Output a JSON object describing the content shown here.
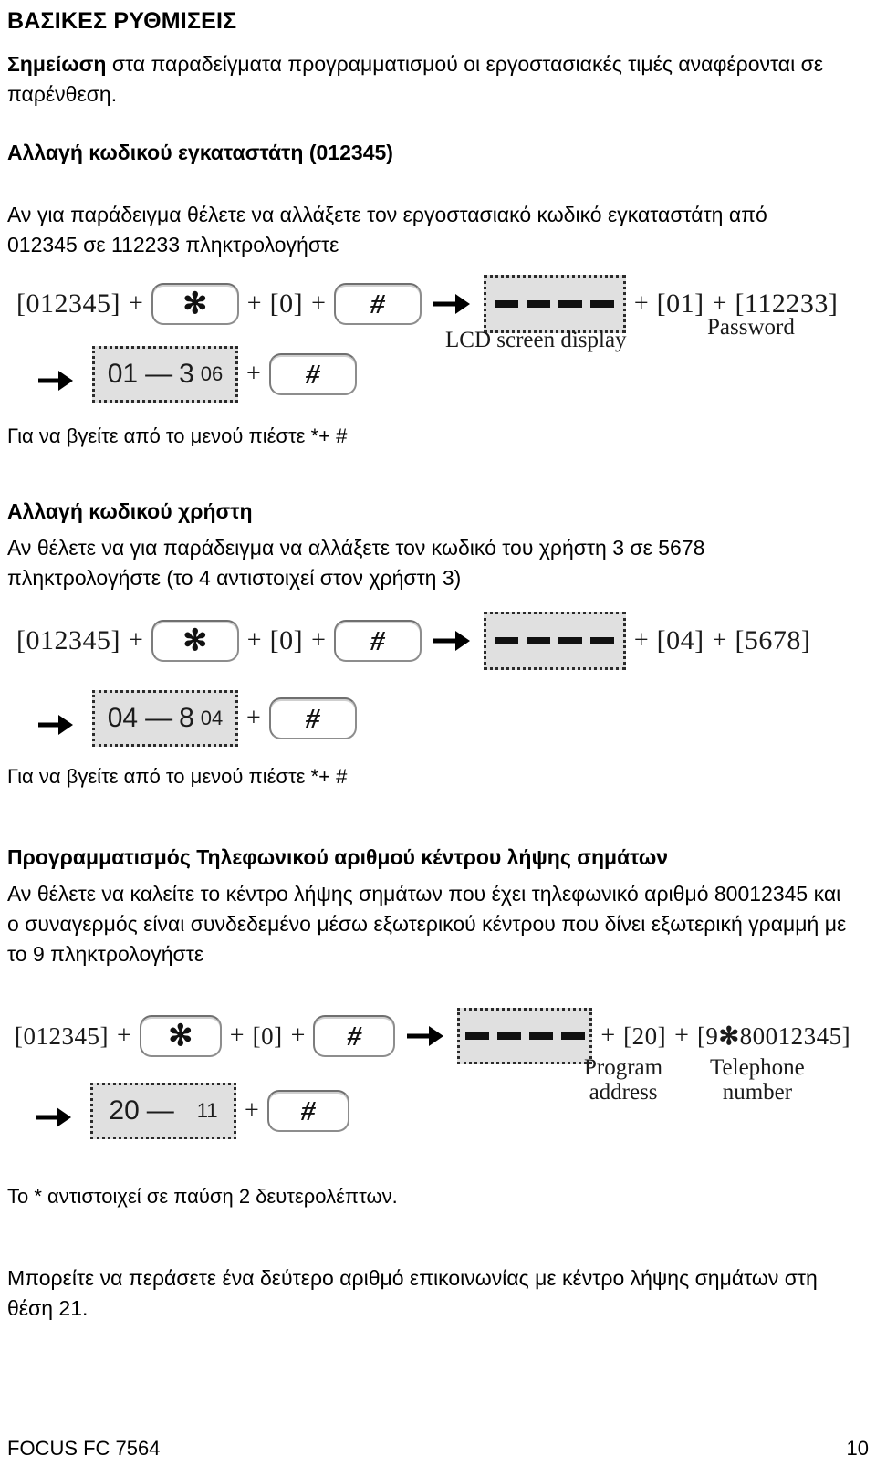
{
  "document": {
    "heading": "ΒΑΣΙΚΕΣ ΡΥΘΜΙΣΕΙΣ",
    "note_label": "Σημείωση",
    "note_text": " στα παραδείγματα προγραμματισμού οι εργοστασιακές τιμές αναφέρονται σε παρένθεση."
  },
  "section_installer": {
    "heading": "Αλλαγή κωδικού εγκαταστάτη (012345)",
    "paragraph": "Αν για παράδειγμα θέλετε να αλλάξετε τον εργοστασιακό κωδικό εγκαταστάτη από 012345 σε 112233 πληκτρολογήστε",
    "exit_note": "Για να βγείτε από το μενού πιέστε *+ #"
  },
  "section_user": {
    "heading": "Αλλαγή κωδικού χρήστη",
    "paragraph": "Αν θέλετε να για παράδειγμα να αλλάξετε τον κωδικό του χρήστη 3 σε 5678 πληκτρολογήστε (το 4 αντιστοιχεί στον χρήστη 3)",
    "exit_note": "Για να βγείτε από το μενού πιέστε *+ #"
  },
  "section_telephone": {
    "heading": "Προγραμματισμός Τηλεφωνικού αριθμού κέντρου λήψης σημάτων",
    "paragraph": "Αν θέλετε να καλείτε το κέντρο λήψης σημάτων που έχει τηλεφωνικό αριθμό 80012345 και ο συναγερμός είναι συνδεδεμένο μέσω εξωτερικού κέντρου που δίνει εξωτερική γραμμή με το 9 πληκτρολογήστε",
    "pause_note": "Το * αντιστοιχεί σε παύση 2 δευτερολέπτων.",
    "second_number_note": "Μπορείτε να περάσετε ένα δεύτερο αριθμό επικοινωνίας με κέντρο λήψης σημάτων στη θέση 21."
  },
  "diagram1": {
    "installer_code": "[012345]",
    "plus": "+",
    "key_star": "✻",
    "zero_code": "[0]",
    "key_hash": "#",
    "lcd_caption": "LCD screen display",
    "address_code": "[01]",
    "password_code": "[112233]",
    "password_caption": "Password",
    "result_left": "01",
    "result_dash": "—",
    "result_mid": "3",
    "result_right": "06"
  },
  "diagram2": {
    "installer_code": "[012345]",
    "plus": "+",
    "key_star": "✻",
    "zero_code": "[0]",
    "key_hash": "#",
    "address_code": "[04]",
    "password_code": "[5678]",
    "result_left": "04",
    "result_dash": "—",
    "result_mid": "8",
    "result_right": "04"
  },
  "diagram3": {
    "installer_code": "[012345]",
    "plus": "+",
    "key_star": "✻",
    "zero_code": "[0]",
    "key_hash": "#",
    "address_code": "[20]",
    "address_caption_line1": "Program",
    "address_caption_line2": "address",
    "phone_prefix": "[9",
    "phone_star": "✻",
    "phone_number": "80012345]",
    "phone_caption_line1": "Telephone",
    "phone_caption_line2": "number",
    "result_left": "20",
    "result_dash": "—",
    "result_right": "11"
  },
  "footer": {
    "model": "FOCUS FC 7564",
    "page_number": "10"
  },
  "colors": {
    "text": "#000000",
    "lcd_fill": "#e0e0e0",
    "key_border": "#8d8d8d"
  }
}
